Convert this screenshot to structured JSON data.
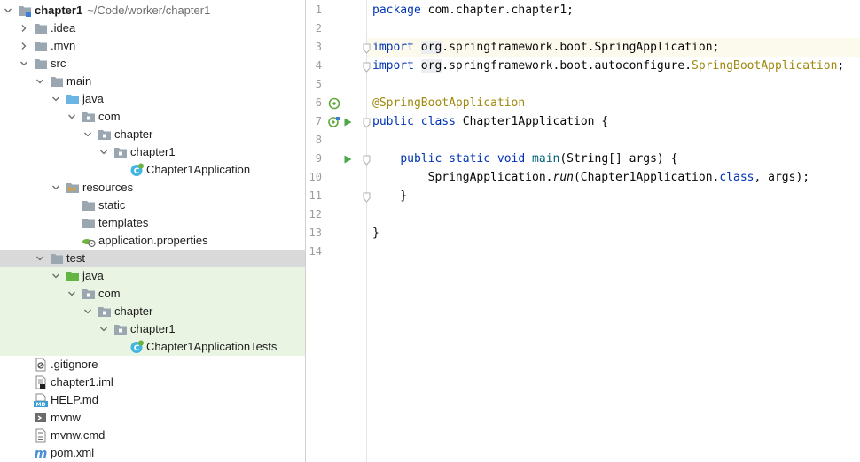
{
  "project": {
    "name": "chapter1",
    "path": "~/Code/worker/chapter1"
  },
  "tree": [
    {
      "label": "chapter1",
      "depth": 0,
      "expanded": true,
      "icon": "module-folder-icon",
      "bold": true
    },
    {
      "label": ".idea",
      "depth": 1,
      "expanded": false,
      "icon": "folder-icon"
    },
    {
      "label": ".mvn",
      "depth": 1,
      "expanded": false,
      "icon": "folder-icon"
    },
    {
      "label": "src",
      "depth": 1,
      "expanded": true,
      "icon": "folder-icon"
    },
    {
      "label": "main",
      "depth": 2,
      "expanded": true,
      "icon": "folder-icon"
    },
    {
      "label": "java",
      "depth": 3,
      "expanded": true,
      "icon": "source-root-icon"
    },
    {
      "label": "com",
      "depth": 4,
      "expanded": true,
      "icon": "package-icon"
    },
    {
      "label": "chapter",
      "depth": 5,
      "expanded": true,
      "icon": "package-icon"
    },
    {
      "label": "chapter1",
      "depth": 6,
      "expanded": true,
      "icon": "package-icon"
    },
    {
      "label": "Chapter1Application",
      "depth": 7,
      "icon": "spring-class-icon"
    },
    {
      "label": "resources",
      "depth": 3,
      "expanded": true,
      "icon": "resources-root-icon"
    },
    {
      "label": "static",
      "depth": 4,
      "icon": "folder-icon"
    },
    {
      "label": "templates",
      "depth": 4,
      "icon": "folder-icon"
    },
    {
      "label": "application.properties",
      "depth": 4,
      "icon": "spring-properties-icon"
    },
    {
      "label": "test",
      "depth": 2,
      "expanded": true,
      "icon": "folder-icon",
      "state": "selected"
    },
    {
      "label": "java",
      "depth": 3,
      "expanded": true,
      "icon": "test-root-icon",
      "state": "test"
    },
    {
      "label": "com",
      "depth": 4,
      "expanded": true,
      "icon": "package-icon",
      "state": "test"
    },
    {
      "label": "chapter",
      "depth": 5,
      "expanded": true,
      "icon": "package-icon",
      "state": "test"
    },
    {
      "label": "chapter1",
      "depth": 6,
      "expanded": true,
      "icon": "package-icon",
      "state": "test"
    },
    {
      "label": "Chapter1ApplicationTests",
      "depth": 7,
      "icon": "spring-class-icon",
      "state": "test"
    },
    {
      "label": ".gitignore",
      "depth": 1,
      "icon": "ignore-file-icon"
    },
    {
      "label": "chapter1.iml",
      "depth": 1,
      "icon": "iml-file-icon"
    },
    {
      "label": "HELP.md",
      "depth": 1,
      "icon": "markdown-file-icon"
    },
    {
      "label": "mvnw",
      "depth": 1,
      "icon": "shell-script-icon"
    },
    {
      "label": "mvnw.cmd",
      "depth": 1,
      "icon": "text-file-icon"
    },
    {
      "label": "pom.xml",
      "depth": 1,
      "icon": "maven-icon"
    }
  ],
  "editor": {
    "line_numbers": [
      "1",
      "2",
      "3",
      "4",
      "5",
      "6",
      "7",
      "8",
      "9",
      "10",
      "11",
      "12",
      "13",
      "14"
    ],
    "highlighted_line": 3,
    "lines": [
      [
        {
          "t": "package",
          "c": "kw"
        },
        {
          "t": " com.chapter.chapter1;"
        }
      ],
      [],
      [
        {
          "t": "import",
          "c": "kw"
        },
        {
          "t": " "
        },
        {
          "t": "org",
          "c": "bad"
        },
        {
          "t": ".springframework.boot.SpringApplication;"
        }
      ],
      [
        {
          "t": "import",
          "c": "kw"
        },
        {
          "t": " "
        },
        {
          "t": "org",
          "c": "bad"
        },
        {
          "t": ".springframework.boot.autoconfigure."
        },
        {
          "t": "SpringBootApplication",
          "c": "ann"
        },
        {
          "t": ";"
        }
      ],
      [],
      [
        {
          "t": "@SpringBootApplication",
          "c": "ann"
        }
      ],
      [
        {
          "t": "public",
          "c": "kw"
        },
        {
          "t": " "
        },
        {
          "t": "class",
          "c": "kw"
        },
        {
          "t": " Chapter1Application {"
        }
      ],
      [],
      [
        {
          "t": "    "
        },
        {
          "t": "public",
          "c": "kw"
        },
        {
          "t": " "
        },
        {
          "t": "static",
          "c": "kw"
        },
        {
          "t": " "
        },
        {
          "t": "void",
          "c": "kw"
        },
        {
          "t": " "
        },
        {
          "t": "main",
          "c": "fn"
        },
        {
          "t": "(String[] args) {"
        }
      ],
      [
        {
          "t": "        SpringApplication."
        },
        {
          "t": "run",
          "c": "it"
        },
        {
          "t": "(Chapter1Application."
        },
        {
          "t": "class",
          "c": "kw"
        },
        {
          "t": ", args);"
        }
      ],
      [
        {
          "t": "    }"
        }
      ],
      [],
      [
        {
          "t": "}"
        }
      ],
      []
    ],
    "gutter_icons": [
      {
        "line": 6,
        "icons": [
          "spring-bean-icon"
        ]
      },
      {
        "line": 7,
        "icons": [
          "spring-run-icon",
          "run-icon"
        ]
      },
      {
        "line": 9,
        "icons": [
          "run-icon"
        ]
      }
    ],
    "fold_lines": [
      3,
      4,
      7,
      9,
      11
    ]
  },
  "colors": {
    "keyword": "#0033b3",
    "annotation": "#9e880d",
    "method": "#00627a",
    "selection": "#d9d9d9",
    "test_scope": "#e9f4e2",
    "caret_line": "#fcfaed"
  }
}
